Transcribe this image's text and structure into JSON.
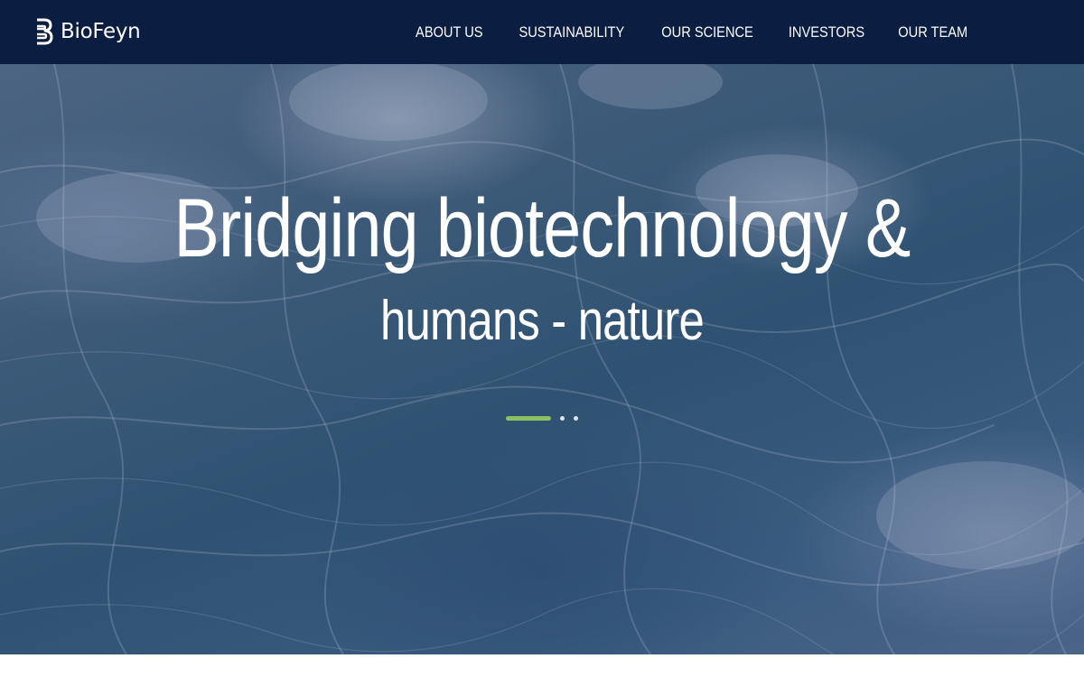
{
  "header": {
    "logo_text": "BioFeyn",
    "nav": [
      {
        "label": "ABOUT US"
      },
      {
        "label": "SUSTAINABILITY"
      },
      {
        "label": "OUR SCIENCE"
      },
      {
        "label": "INVESTORS"
      },
      {
        "label": "OUR TEAM"
      }
    ]
  },
  "hero": {
    "headline": "Bridging biotechnology &",
    "subheadline": "humans - nature",
    "slider": {
      "total_slides": 3,
      "active_slide": 1,
      "active_color": "#8cc063"
    }
  },
  "colors": {
    "nav_background": "#0b1d41",
    "text": "#ffffff"
  },
  "icons": {
    "logo": "biofeyn-logo-icon"
  }
}
